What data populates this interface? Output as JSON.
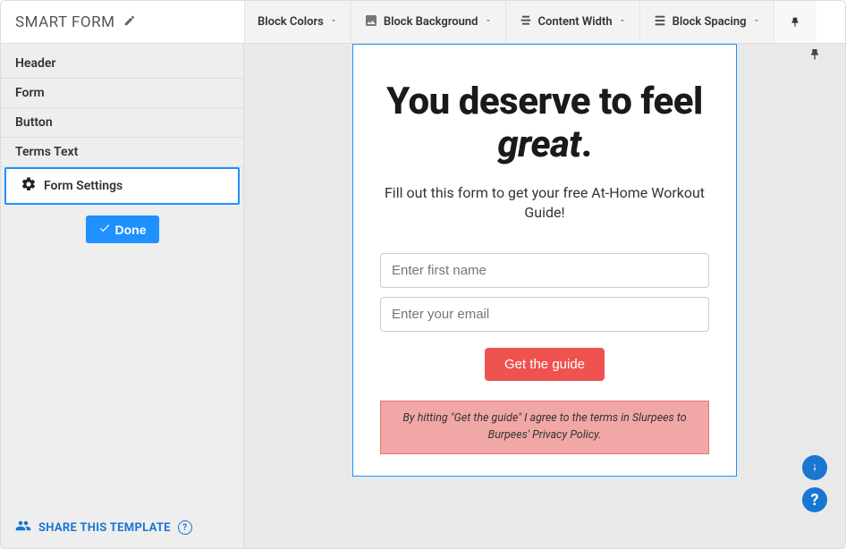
{
  "toolbar": {
    "title": "SMART FORM",
    "block_colors": "Block Colors",
    "block_background": "Block Background",
    "content_width": "Content Width",
    "block_spacing": "Block Spacing"
  },
  "sidebar": {
    "items": [
      {
        "label": "Header"
      },
      {
        "label": "Form"
      },
      {
        "label": "Button"
      },
      {
        "label": "Terms Text"
      },
      {
        "label": "Form Settings"
      }
    ],
    "done": "Done",
    "share": "SHARE THIS TEMPLATE"
  },
  "preview": {
    "heading_pre": "You deserve to feel ",
    "heading_em": "great",
    "heading_post": ".",
    "subheading": "Fill out this form to get your free At-Home Workout Guide!",
    "input1_placeholder": "Enter first name",
    "input2_placeholder": "Enter your email",
    "cta": "Get the guide",
    "terms": "By hitting \"Get the guide\" I agree to the terms in Slurpees to Burpees' Privacy Policy."
  }
}
